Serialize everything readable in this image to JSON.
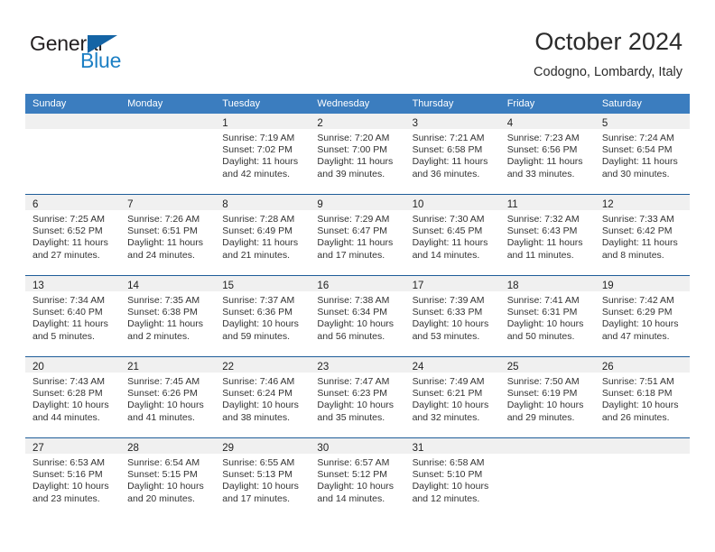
{
  "logo": {
    "word_one": "General",
    "word_two": "Blue",
    "flag_icon": "triangle-flag-icon",
    "accent_color": "#1464a5",
    "blue_text_color": "#1c7fc4"
  },
  "header": {
    "title": "October 2024",
    "subtitle": "Codogno, Lombardy, Italy"
  },
  "calendar": {
    "header_bg": "#3b7dbf",
    "daynum_band_bg": "#f0f0f0",
    "row_divider_color": "#1f5d99",
    "weekday_headers": [
      "Sunday",
      "Monday",
      "Tuesday",
      "Wednesday",
      "Thursday",
      "Friday",
      "Saturday"
    ],
    "weeks": [
      [
        {
          "day": "",
          "lines": []
        },
        {
          "day": "",
          "lines": []
        },
        {
          "day": "1",
          "lines": [
            "Sunrise: 7:19 AM",
            "Sunset: 7:02 PM",
            "Daylight: 11 hours",
            "and 42 minutes."
          ]
        },
        {
          "day": "2",
          "lines": [
            "Sunrise: 7:20 AM",
            "Sunset: 7:00 PM",
            "Daylight: 11 hours",
            "and 39 minutes."
          ]
        },
        {
          "day": "3",
          "lines": [
            "Sunrise: 7:21 AM",
            "Sunset: 6:58 PM",
            "Daylight: 11 hours",
            "and 36 minutes."
          ]
        },
        {
          "day": "4",
          "lines": [
            "Sunrise: 7:23 AM",
            "Sunset: 6:56 PM",
            "Daylight: 11 hours",
            "and 33 minutes."
          ]
        },
        {
          "day": "5",
          "lines": [
            "Sunrise: 7:24 AM",
            "Sunset: 6:54 PM",
            "Daylight: 11 hours",
            "and 30 minutes."
          ]
        }
      ],
      [
        {
          "day": "6",
          "lines": [
            "Sunrise: 7:25 AM",
            "Sunset: 6:52 PM",
            "Daylight: 11 hours",
            "and 27 minutes."
          ]
        },
        {
          "day": "7",
          "lines": [
            "Sunrise: 7:26 AM",
            "Sunset: 6:51 PM",
            "Daylight: 11 hours",
            "and 24 minutes."
          ]
        },
        {
          "day": "8",
          "lines": [
            "Sunrise: 7:28 AM",
            "Sunset: 6:49 PM",
            "Daylight: 11 hours",
            "and 21 minutes."
          ]
        },
        {
          "day": "9",
          "lines": [
            "Sunrise: 7:29 AM",
            "Sunset: 6:47 PM",
            "Daylight: 11 hours",
            "and 17 minutes."
          ]
        },
        {
          "day": "10",
          "lines": [
            "Sunrise: 7:30 AM",
            "Sunset: 6:45 PM",
            "Daylight: 11 hours",
            "and 14 minutes."
          ]
        },
        {
          "day": "11",
          "lines": [
            "Sunrise: 7:32 AM",
            "Sunset: 6:43 PM",
            "Daylight: 11 hours",
            "and 11 minutes."
          ]
        },
        {
          "day": "12",
          "lines": [
            "Sunrise: 7:33 AM",
            "Sunset: 6:42 PM",
            "Daylight: 11 hours",
            "and 8 minutes."
          ]
        }
      ],
      [
        {
          "day": "13",
          "lines": [
            "Sunrise: 7:34 AM",
            "Sunset: 6:40 PM",
            "Daylight: 11 hours",
            "and 5 minutes."
          ]
        },
        {
          "day": "14",
          "lines": [
            "Sunrise: 7:35 AM",
            "Sunset: 6:38 PM",
            "Daylight: 11 hours",
            "and 2 minutes."
          ]
        },
        {
          "day": "15",
          "lines": [
            "Sunrise: 7:37 AM",
            "Sunset: 6:36 PM",
            "Daylight: 10 hours",
            "and 59 minutes."
          ]
        },
        {
          "day": "16",
          "lines": [
            "Sunrise: 7:38 AM",
            "Sunset: 6:34 PM",
            "Daylight: 10 hours",
            "and 56 minutes."
          ]
        },
        {
          "day": "17",
          "lines": [
            "Sunrise: 7:39 AM",
            "Sunset: 6:33 PM",
            "Daylight: 10 hours",
            "and 53 minutes."
          ]
        },
        {
          "day": "18",
          "lines": [
            "Sunrise: 7:41 AM",
            "Sunset: 6:31 PM",
            "Daylight: 10 hours",
            "and 50 minutes."
          ]
        },
        {
          "day": "19",
          "lines": [
            "Sunrise: 7:42 AM",
            "Sunset: 6:29 PM",
            "Daylight: 10 hours",
            "and 47 minutes."
          ]
        }
      ],
      [
        {
          "day": "20",
          "lines": [
            "Sunrise: 7:43 AM",
            "Sunset: 6:28 PM",
            "Daylight: 10 hours",
            "and 44 minutes."
          ]
        },
        {
          "day": "21",
          "lines": [
            "Sunrise: 7:45 AM",
            "Sunset: 6:26 PM",
            "Daylight: 10 hours",
            "and 41 minutes."
          ]
        },
        {
          "day": "22",
          "lines": [
            "Sunrise: 7:46 AM",
            "Sunset: 6:24 PM",
            "Daylight: 10 hours",
            "and 38 minutes."
          ]
        },
        {
          "day": "23",
          "lines": [
            "Sunrise: 7:47 AM",
            "Sunset: 6:23 PM",
            "Daylight: 10 hours",
            "and 35 minutes."
          ]
        },
        {
          "day": "24",
          "lines": [
            "Sunrise: 7:49 AM",
            "Sunset: 6:21 PM",
            "Daylight: 10 hours",
            "and 32 minutes."
          ]
        },
        {
          "day": "25",
          "lines": [
            "Sunrise: 7:50 AM",
            "Sunset: 6:19 PM",
            "Daylight: 10 hours",
            "and 29 minutes."
          ]
        },
        {
          "day": "26",
          "lines": [
            "Sunrise: 7:51 AM",
            "Sunset: 6:18 PM",
            "Daylight: 10 hours",
            "and 26 minutes."
          ]
        }
      ],
      [
        {
          "day": "27",
          "lines": [
            "Sunrise: 6:53 AM",
            "Sunset: 5:16 PM",
            "Daylight: 10 hours",
            "and 23 minutes."
          ]
        },
        {
          "day": "28",
          "lines": [
            "Sunrise: 6:54 AM",
            "Sunset: 5:15 PM",
            "Daylight: 10 hours",
            "and 20 minutes."
          ]
        },
        {
          "day": "29",
          "lines": [
            "Sunrise: 6:55 AM",
            "Sunset: 5:13 PM",
            "Daylight: 10 hours",
            "and 17 minutes."
          ]
        },
        {
          "day": "30",
          "lines": [
            "Sunrise: 6:57 AM",
            "Sunset: 5:12 PM",
            "Daylight: 10 hours",
            "and 14 minutes."
          ]
        },
        {
          "day": "31",
          "lines": [
            "Sunrise: 6:58 AM",
            "Sunset: 5:10 PM",
            "Daylight: 10 hours",
            "and 12 minutes."
          ]
        },
        {
          "day": "",
          "lines": []
        },
        {
          "day": "",
          "lines": []
        }
      ]
    ]
  }
}
